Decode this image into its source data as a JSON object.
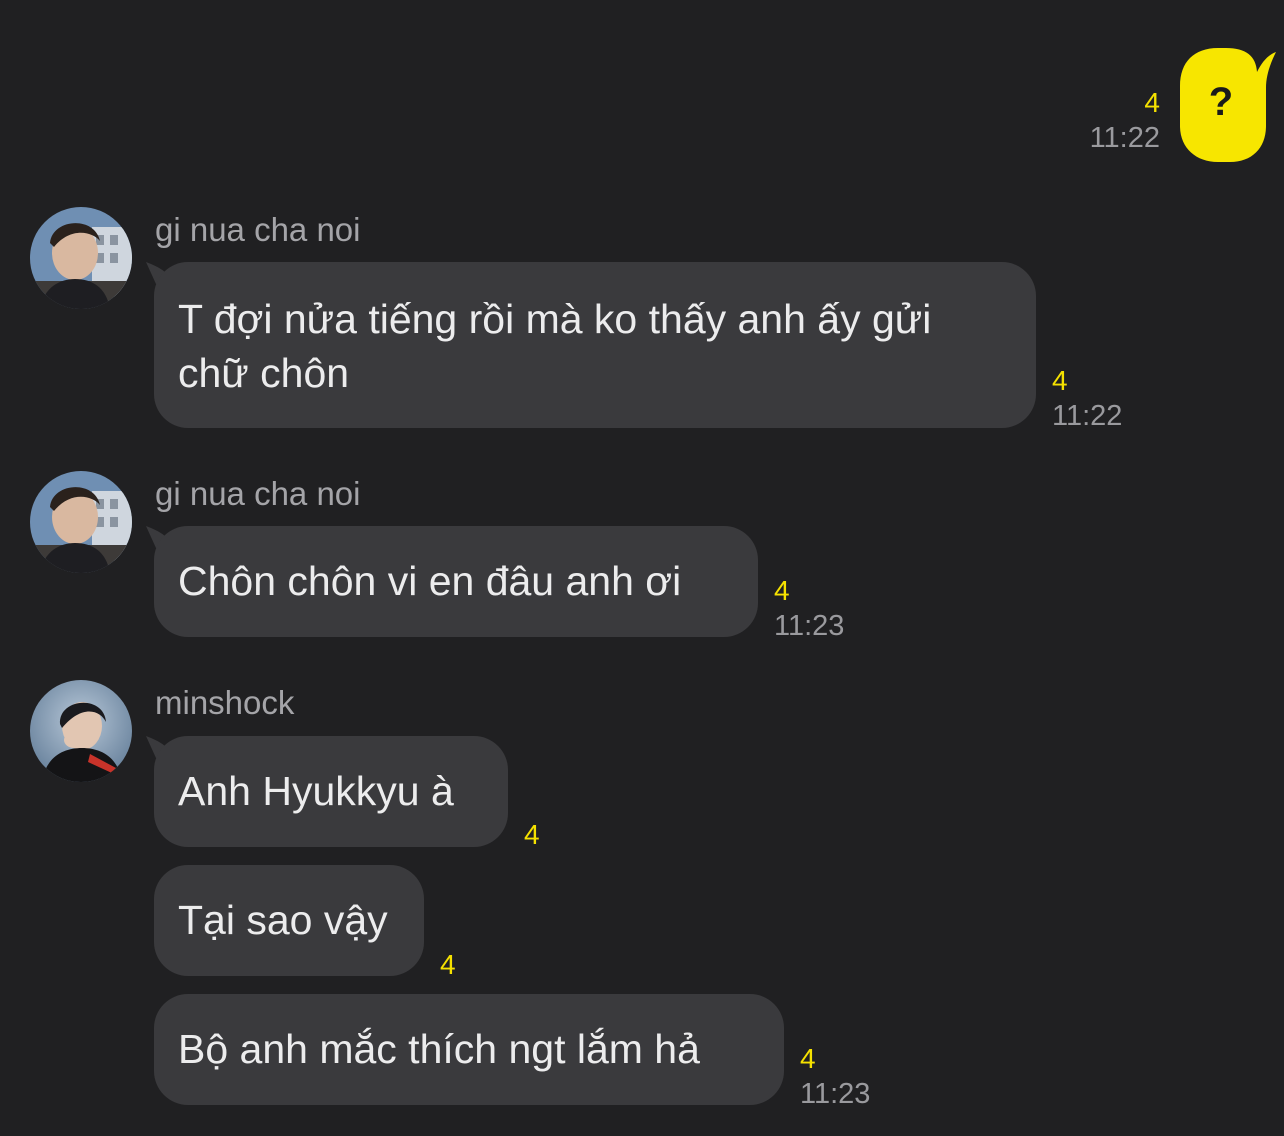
{
  "colors": {
    "background": "#202022",
    "bubble_incoming": "#3a3a3d",
    "bubble_outgoing": "#f7e600",
    "unread": "#f5e100",
    "timestamp": "#9a9a9e"
  },
  "outgoing": {
    "text": "?",
    "unread": "4",
    "time": "11:22"
  },
  "groups": [
    {
      "sender": "gi nua cha noi",
      "avatar_icon": "profile-photo-icon",
      "messages": [
        {
          "text": "T đợi nửa tiếng rồi mà ko thấy anh ấy gửi chữ chôn",
          "unread": "4",
          "time": "11:22"
        }
      ]
    },
    {
      "sender": "gi nua cha noi",
      "avatar_icon": "profile-photo-icon",
      "messages": [
        {
          "text": "Chôn chôn vi en đâu anh ơi",
          "unread": "4",
          "time": "11:23"
        }
      ]
    },
    {
      "sender": "minshock",
      "avatar_icon": "profile-photo-icon",
      "messages": [
        {
          "text": "Anh Hyukkyu à",
          "unread": "4",
          "time": ""
        },
        {
          "text": "Tại sao vậy",
          "unread": "4",
          "time": ""
        },
        {
          "text": "Bộ anh mắc thích ngt lắm hả",
          "unread": "4",
          "time": "11:23"
        }
      ]
    }
  ]
}
